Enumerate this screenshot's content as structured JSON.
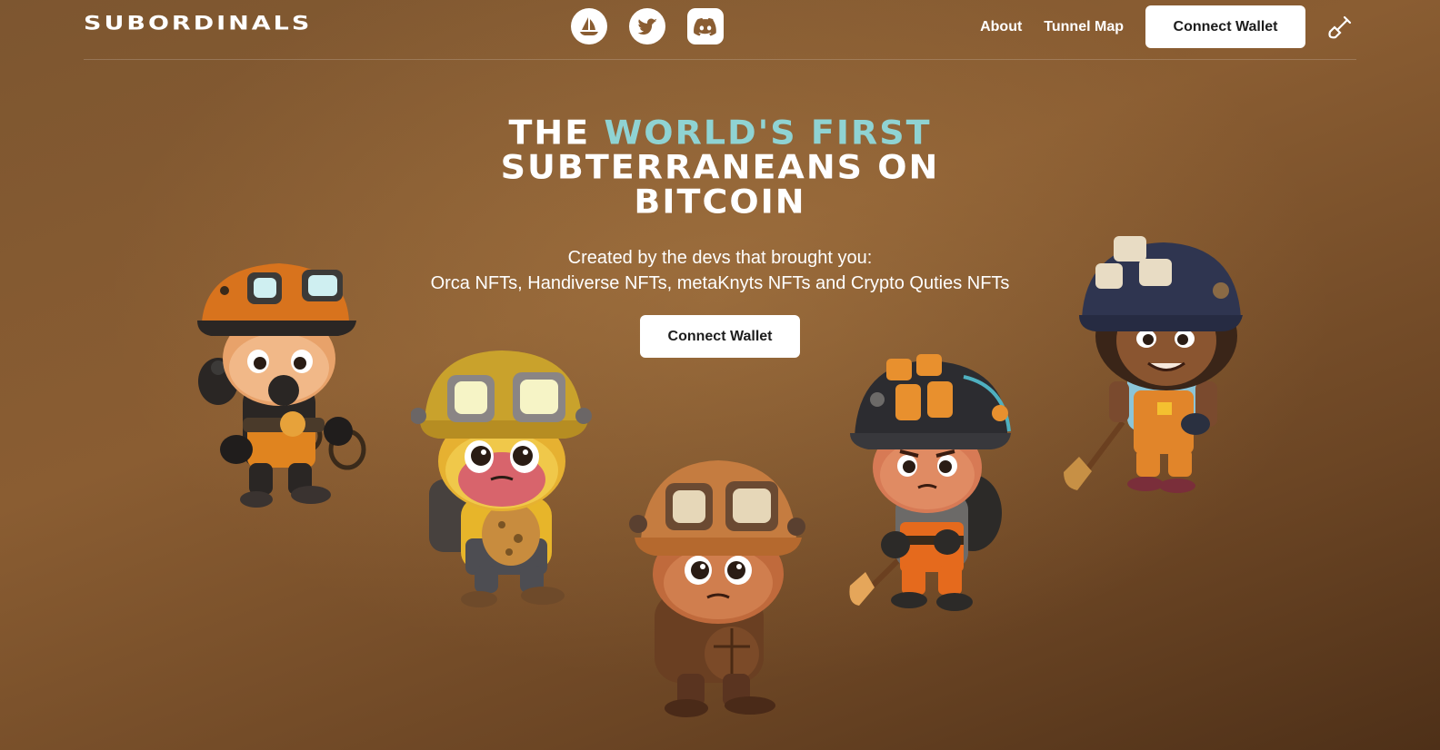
{
  "brand": {
    "logo_text": "SUBORDINALS"
  },
  "header": {
    "socials": [
      {
        "name": "opensea",
        "icon": "boat-icon"
      },
      {
        "name": "twitter",
        "icon": "bird-icon"
      },
      {
        "name": "discord",
        "icon": "discord-icon"
      }
    ],
    "nav": {
      "about": "About",
      "tunnel_map": "Tunnel Map"
    },
    "connect_label": "Connect Wallet",
    "tool_icon": "shovel-icon"
  },
  "hero": {
    "title_part1": "THE ",
    "title_accent": "WORLD'S FIRST",
    "title_part2": "SUBTERRANEANS ON",
    "title_part3": "BITCOIN",
    "subtitle_line1": "Created by the devs that brought you:",
    "subtitle_line2": "Orca NFTs, Handiverse NFTs, metaKnyts NFTs and Crypto Quties NFTs",
    "cta_label": "Connect Wallet"
  },
  "colors": {
    "accent": "#8fd3d3",
    "background": "#7d5630",
    "button_bg": "#ffffff"
  },
  "characters": [
    {
      "name": "miner-orange-helmet",
      "icon": "miner-character"
    },
    {
      "name": "miner-yellow-helmet",
      "icon": "miner-character"
    },
    {
      "name": "miner-bronze-helmet",
      "icon": "miner-character"
    },
    {
      "name": "miner-dark-helmet-shovel",
      "icon": "miner-character"
    },
    {
      "name": "miner-blue-helmet-shovel",
      "icon": "miner-character"
    }
  ]
}
